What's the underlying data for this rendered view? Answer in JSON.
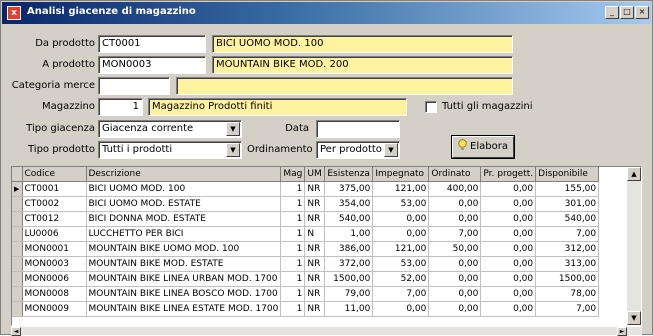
{
  "window": {
    "title": "Analisi giacenze di magazzino",
    "min_glyph": "_",
    "max_glyph": "□",
    "close_glyph": "×",
    "icon_glyph": "x"
  },
  "form": {
    "da_prodotto_label": "Da prodotto",
    "da_prodotto_code": "CT0001",
    "da_prodotto_desc": "BICI UOMO MOD. 100",
    "a_prodotto_label": "A prodotto",
    "a_prodotto_code": "MON0003",
    "a_prodotto_desc": "MOUNTAIN BIKE MOD. 200",
    "categoria_label": "Categoria merce",
    "categoria_code": "",
    "categoria_desc": "",
    "magazzino_label": "Magazzino",
    "magazzino_code": "1",
    "magazzino_desc": "Magazzino Prodotti finiti",
    "tutti_label": "Tutti gli magazzini",
    "tipo_giacenza_label": "Tipo giacenza",
    "tipo_giacenza_value": "Giacenza corrente",
    "data_label": "Data",
    "data_value": "",
    "tipo_prodotto_label": "Tipo prodotto",
    "tipo_prodotto_value": "Tutti i prodotti",
    "ordinamento_label": "Ordinamento",
    "ordinamento_value": "Per prodotto",
    "elabora_label": "Elabora",
    "elabora_icon": "lightbulb-icon"
  },
  "table": {
    "columns": [
      "Codice",
      "Descrizione",
      "Mag",
      "UM",
      "Esistenza",
      "Impegnato",
      "Ordinato",
      "Pr. progett.",
      "Disponibile"
    ],
    "rows": [
      [
        "CT0001",
        "BICI UOMO MOD. 100",
        "1",
        "NR",
        "375,00",
        "121,00",
        "400,00",
        "0,00",
        "155,00"
      ],
      [
        "CT0002",
        "BICI UOMO MOD. ESTATE",
        "1",
        "NR",
        "354,00",
        "53,00",
        "0,00",
        "0,00",
        "301,00"
      ],
      [
        "CT0012",
        "BICI DONNA MOD. ESTATE",
        "1",
        "NR",
        "540,00",
        "0,00",
        "0,00",
        "0,00",
        "540,00"
      ],
      [
        "LU0006",
        "LUCCHETTO PER BICI",
        "1",
        "N",
        "1,00",
        "0,00",
        "7,00",
        "0,00",
        "7,00"
      ],
      [
        "MON0001",
        "MOUNTAIN BIKE UOMO MOD. 100",
        "1",
        "NR",
        "386,00",
        "121,00",
        "50,00",
        "0,00",
        "312,00"
      ],
      [
        "MON0003",
        "MOUNTAIN BIKE MOD. ESTATE",
        "1",
        "NR",
        "372,00",
        "53,00",
        "0,00",
        "0,00",
        "313,00"
      ],
      [
        "MON0006",
        "MOUNTAIN BIKE LINEA URBAN MOD. 1700",
        "1",
        "NR",
        "1500,00",
        "52,00",
        "0,00",
        "0,00",
        "1500,00"
      ],
      [
        "MON0008",
        "MOUNTAIN BIKE LINEA BOSCO MOD. 1700",
        "1",
        "NR",
        "79,00",
        "7,00",
        "0,00",
        "0,00",
        "78,00"
      ],
      [
        "MON0009",
        "MOUNTAIN BIKE LINEA ESTATE MOD. 1700",
        "1",
        "NR",
        "11,00",
        "0,00",
        "0,00",
        "0,00",
        "7,00"
      ]
    ]
  },
  "scroll": {
    "up": "▲",
    "down": "▼",
    "left": "◄",
    "right": "►"
  },
  "indicator": "▶",
  "combo_arrow": "▼"
}
